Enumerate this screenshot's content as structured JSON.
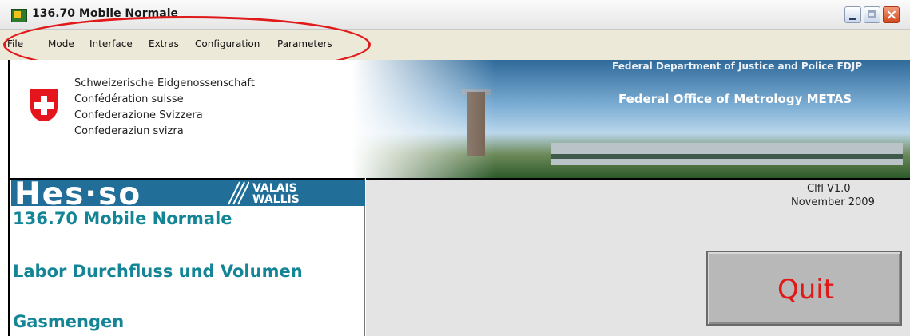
{
  "window": {
    "title": "136.70 Mobile Normale",
    "controls": {
      "minimize": "minimize",
      "maximize": "maximize",
      "close": "close"
    }
  },
  "menu": {
    "items": [
      "File",
      "Mode",
      "Interface",
      "Extras",
      "Configuration",
      "Parameters"
    ]
  },
  "banner": {
    "confederation_lines": [
      "Schweizerische Eidgenossenschaft",
      "Confédération suisse",
      "Confederazione Svizzera",
      "Confederaziun svizra"
    ],
    "department": "Federal Department of Justice and Police FDJP",
    "office": "Federal Office of Metrology METAS"
  },
  "logo": {
    "text": "Hes·so",
    "valais": "VALAIS",
    "wallis": "WALLIS"
  },
  "info": {
    "titles": [
      "136.70 Mobile Normale",
      "Labor Durchfluss und Volumen",
      "Gasmengen"
    ],
    "version": "Clfl  V1.0",
    "date": "November 2009"
  },
  "actions": {
    "quit_label": "Quit"
  },
  "colors": {
    "annotation": "#e01a1a",
    "teal": "#138596",
    "logo_blue": "#216f99",
    "quit_text": "#e01818"
  }
}
